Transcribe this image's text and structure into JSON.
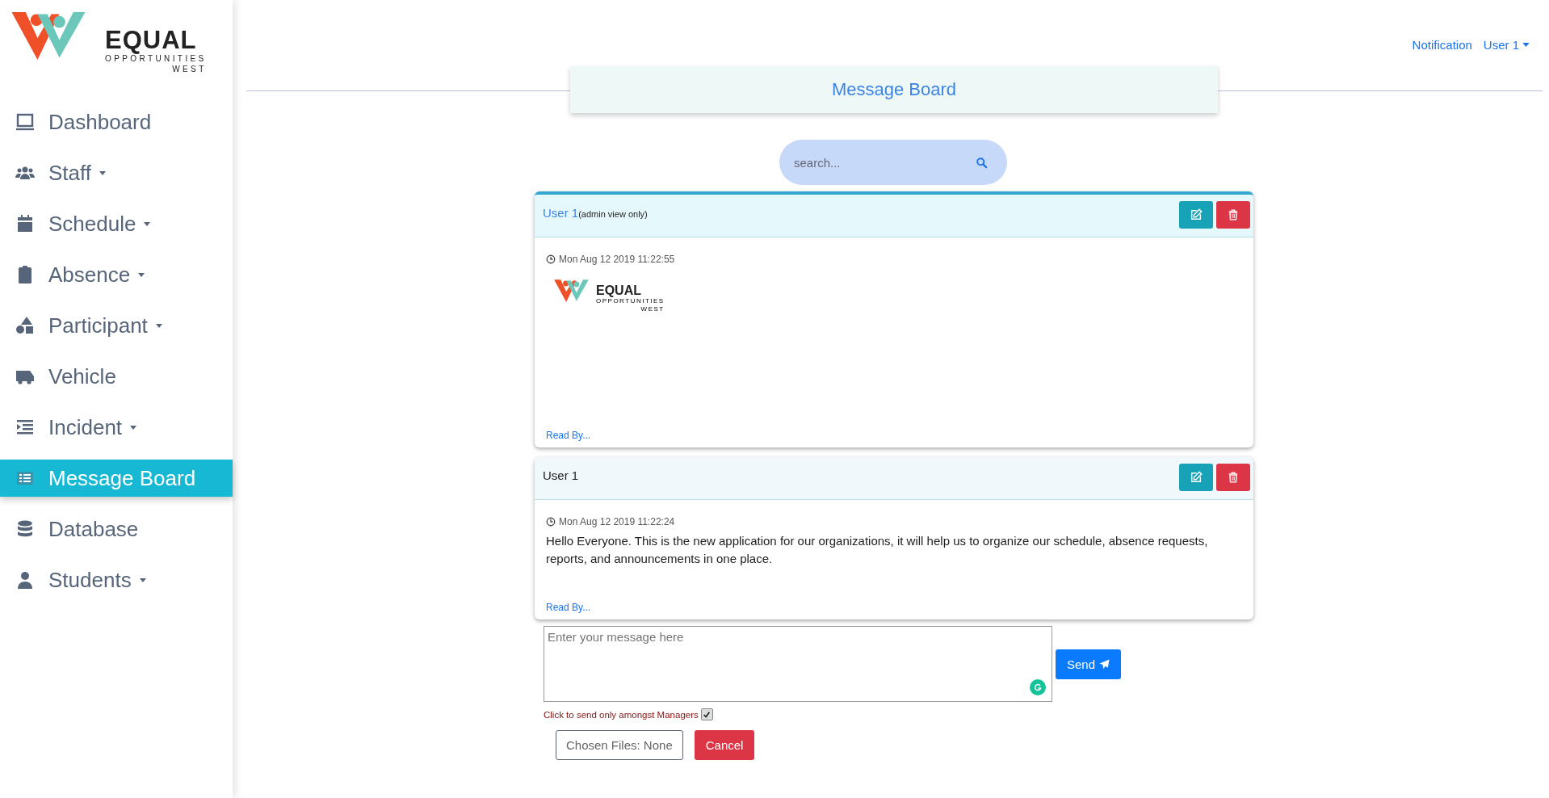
{
  "logo": {
    "title": "EQUAL",
    "subtitle": "OPPORTUNITIES",
    "region": "WEST"
  },
  "sidebar": {
    "items": [
      {
        "label": "Dashboard",
        "dropdown": false,
        "selected": false
      },
      {
        "label": "Staff",
        "dropdown": true,
        "selected": false
      },
      {
        "label": "Schedule",
        "dropdown": true,
        "selected": false
      },
      {
        "label": "Absence",
        "dropdown": true,
        "selected": false
      },
      {
        "label": "Participant",
        "dropdown": true,
        "selected": false
      },
      {
        "label": "Vehicle",
        "dropdown": false,
        "selected": false
      },
      {
        "label": "Incident",
        "dropdown": true,
        "selected": false
      },
      {
        "label": "Message Board",
        "dropdown": false,
        "selected": true
      },
      {
        "label": "Database",
        "dropdown": false,
        "selected": false
      },
      {
        "label": "Students",
        "dropdown": true,
        "selected": false
      }
    ]
  },
  "topbar": {
    "links": [
      "Notification"
    ],
    "user": "User 1"
  },
  "page_title": "Message Board",
  "search": {
    "placeholder": "search..."
  },
  "posts": [
    {
      "kind": "image",
      "author": "User 1",
      "note": "(admin view only)",
      "highlighted": true,
      "time": "Mon Aug 12 2019 11:22:55",
      "image": {
        "title": "EQUAL",
        "subtitle": "OPPORTUNITIES",
        "region": "WEST"
      },
      "read_by": "Read By..."
    },
    {
      "kind": "text",
      "author": "User 1",
      "highlighted": false,
      "time": "Mon Aug 12 2019 11:22:24",
      "text": "Hello Everyone. This is the new application for our organizations, it will help us to organize our schedule, absence requests, reports, and announcements in one place.",
      "read_by": "Read By..."
    }
  ],
  "composer": {
    "placeholder": "Enter your message here",
    "send": "Send",
    "managers_label": "Click to send only amongst Managers",
    "managers_only": true,
    "files": "Chosen Files: None",
    "cancel": "Cancel"
  }
}
